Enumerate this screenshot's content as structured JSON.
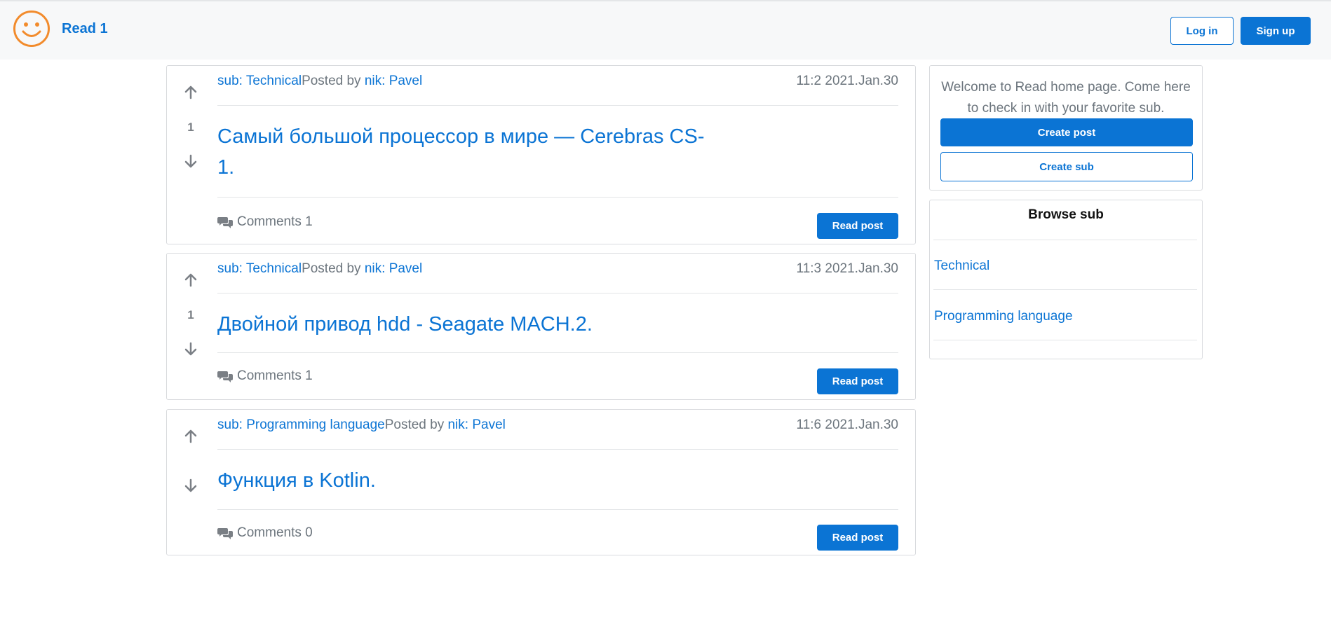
{
  "header": {
    "brand": "Read 1",
    "login_label": "Log in",
    "signup_label": "Sign up"
  },
  "posts": [
    {
      "sub": "sub: Technical",
      "posted_by": "Posted by ",
      "author": "nik: Pavel",
      "time": "11:2 2021.Jan.30",
      "votes": "1",
      "title": "Самый большой процессор в мире — Cerebras CS-1.",
      "comments": "Comments 1",
      "read_label": "Read post"
    },
    {
      "sub": "sub: Technical",
      "posted_by": "Posted by ",
      "author": "nik: Pavel",
      "time": "11:3 2021.Jan.30",
      "votes": "1",
      "title": "Двойной привод hdd - Seagate MACH.2.",
      "comments": "Comments 1",
      "read_label": "Read post"
    },
    {
      "sub": "sub: Programming language",
      "posted_by": "Posted by ",
      "author": "nik: Pavel",
      "time": "11:6 2021.Jan.30",
      "votes": "",
      "title": "Функция в Kotlin.",
      "comments": "Comments 0",
      "read_label": "Read post"
    }
  ],
  "sidebar": {
    "welcome": "Welcome to Read home page. Come here to check in with your favorite sub.",
    "create_post_label": "Create post",
    "create_sub_label": "Create sub",
    "browse_title": "Browse sub",
    "subs": [
      "Technical",
      "Programming language"
    ]
  },
  "colors": {
    "accent": "#0b74d4",
    "logo": "#f28b2c",
    "muted": "#6c757d"
  },
  "icons": {
    "logo": "smiley-icon",
    "upvote": "arrow-up-icon",
    "downvote": "arrow-down-icon",
    "comments": "comments-icon"
  }
}
